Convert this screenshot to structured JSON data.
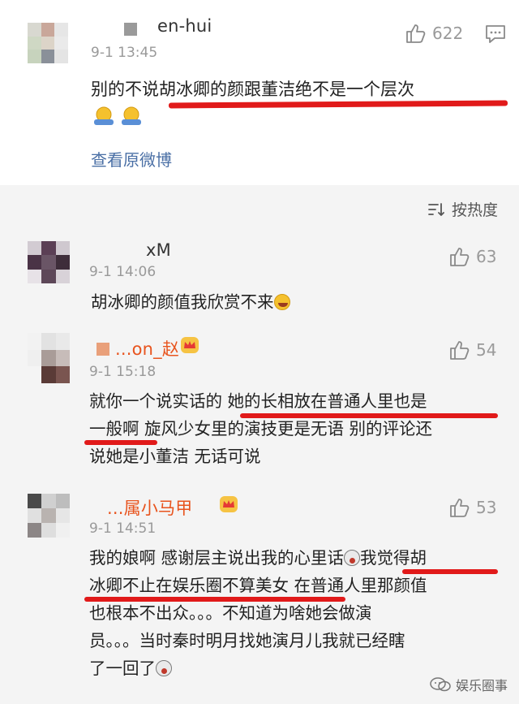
{
  "top_comment": {
    "username": "en-hui",
    "time": "9-1 13:45",
    "likes": "622",
    "text": "别的不说胡冰卿的颜跟董洁绝不是一个层次",
    "view_original": "查看原微博"
  },
  "sort_label": "按热度",
  "comments": [
    {
      "username": "xM",
      "time": "9-1 14:06",
      "likes": "63",
      "lines": [
        "胡冰卿的颜值我欣赏不来"
      ]
    },
    {
      "username": "...on_赵",
      "time": "9-1 15:18",
      "likes": "54",
      "lines": [
        "就你一个说实话的 她的长相放在普通人里也是",
        "一般啊 旋风少女里的演技更是无语 别的评论还",
        "说她是小董洁 无话可说"
      ]
    },
    {
      "username": "...属小马甲",
      "time": "9-1 14:51",
      "likes": "53",
      "lines": [
        "我的娘啊 感谢层主说出我的心里话",
        "我觉得胡",
        "冰卿不止在娱乐圈不算美女 在普通人里那颜值",
        "也根本不出众。。。不知道为啥她会做演",
        "员。。。当时秦时明月找她演月儿我就已经瞎",
        "了一回了"
      ]
    }
  ],
  "watermark": "娱乐圈事",
  "colors": {
    "underline": "#e11a1a",
    "link": "#4a6fa5",
    "gray_bg": "#f4f4f4"
  }
}
